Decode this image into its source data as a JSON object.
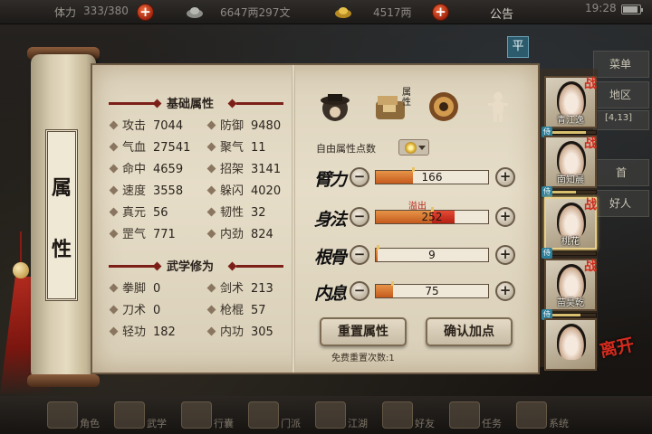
{
  "topbar": {
    "stamina_label": "体力",
    "stamina_value": "333/380",
    "money_value": "6647两297文",
    "gold_value": "4517两",
    "notice": "公告",
    "time": "19:28"
  },
  "scene": {
    "menu_btn": "平",
    "side_labels": [
      "菜单",
      "地区",
      "[4,13]",
      "首",
      "好人"
    ]
  },
  "scroll": {
    "title_top": "属",
    "title_bottom": "性"
  },
  "basic": {
    "heading": "基础属性",
    "stats": [
      {
        "label": "攻击",
        "value": "7044"
      },
      {
        "label": "防御",
        "value": "9480"
      },
      {
        "label": "气血",
        "value": "27541"
      },
      {
        "label": "聚气",
        "value": "11"
      },
      {
        "label": "命中",
        "value": "4659"
      },
      {
        "label": "招架",
        "value": "3141"
      },
      {
        "label": "速度",
        "value": "3558"
      },
      {
        "label": "躲闪",
        "value": "4020"
      },
      {
        "label": "真元",
        "value": "56"
      },
      {
        "label": "韧性",
        "value": "32"
      },
      {
        "label": "罡气",
        "value": "771"
      },
      {
        "label": "内劲",
        "value": "824"
      }
    ]
  },
  "martial": {
    "heading": "武学修为",
    "stats": [
      {
        "label": "拳脚",
        "value": "0"
      },
      {
        "label": "剑术",
        "value": "213"
      },
      {
        "label": "刀术",
        "value": "0"
      },
      {
        "label": "枪棍",
        "value": "57"
      },
      {
        "label": "轻功",
        "value": "182"
      },
      {
        "label": "内功",
        "value": "305"
      }
    ]
  },
  "right": {
    "free_points_label": "自由属性点数",
    "overflow_label": "溢出",
    "attrs": [
      {
        "label": "臂力",
        "value": "166",
        "progress": 0.33
      },
      {
        "label": "身法",
        "value": "252",
        "progress": 0.5,
        "overflow": 0.2
      },
      {
        "label": "根骨",
        "value": "9",
        "progress": 0.02
      },
      {
        "label": "内息",
        "value": "75",
        "progress": 0.15
      }
    ],
    "reset_button": "重置属性",
    "confirm_button": "确认加点",
    "free_reset_text": "免费重置次数:1",
    "category_icons": [
      "hat-icon",
      "bag-icon",
      "wheel-icon",
      "figure-icon"
    ],
    "category_active_label": "属性"
  },
  "characters": [
    {
      "name": "青江逸",
      "battle": "战",
      "hp": 0.8
    },
    {
      "name": "南知晨",
      "battle": "战",
      "hp": 0.6
    },
    {
      "name": "桃花",
      "battle": "战",
      "hp": 0.0
    },
    {
      "name": "苗昊乾",
      "battle": "战",
      "hp": 0.7
    },
    {
      "name": "",
      "battle": "",
      "hp": 0.0
    }
  ],
  "char_tag": "侍",
  "leave_label": "离开",
  "dock": {
    "items": [
      "角色",
      "武学",
      "行囊",
      "门派",
      "江湖",
      "好友",
      "任务",
      "系统"
    ]
  },
  "colors": {
    "accent_red": "#7b1f18",
    "bar_fill": "#c45a1d",
    "overflow_red": "#b31f12",
    "parchment": "#e6ddc8"
  }
}
